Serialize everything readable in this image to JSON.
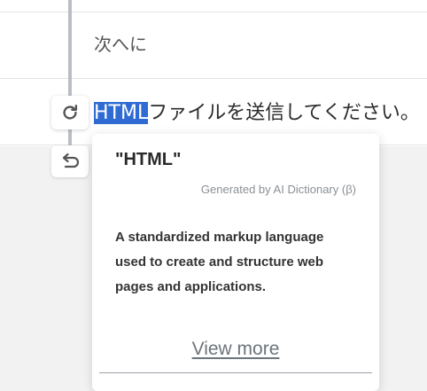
{
  "editor": {
    "line_1": "次へに",
    "line_2_selected": "HTML",
    "line_2_rest": "ファイルを送信してください。"
  },
  "side_buttons": [
    {
      "icon": "refresh-icon"
    },
    {
      "icon": "return-icon"
    }
  ],
  "dictionary_popup": {
    "term": "\"HTML\"",
    "source": "Generated by AI Dictionary (β)",
    "definition": "A standardized markup language used to create and structure web pages and applications.",
    "view_more": "View more"
  },
  "colors": {
    "selection": "#2f6bd2",
    "rail": "#b9bec4",
    "muted_text": "#8a9096"
  }
}
